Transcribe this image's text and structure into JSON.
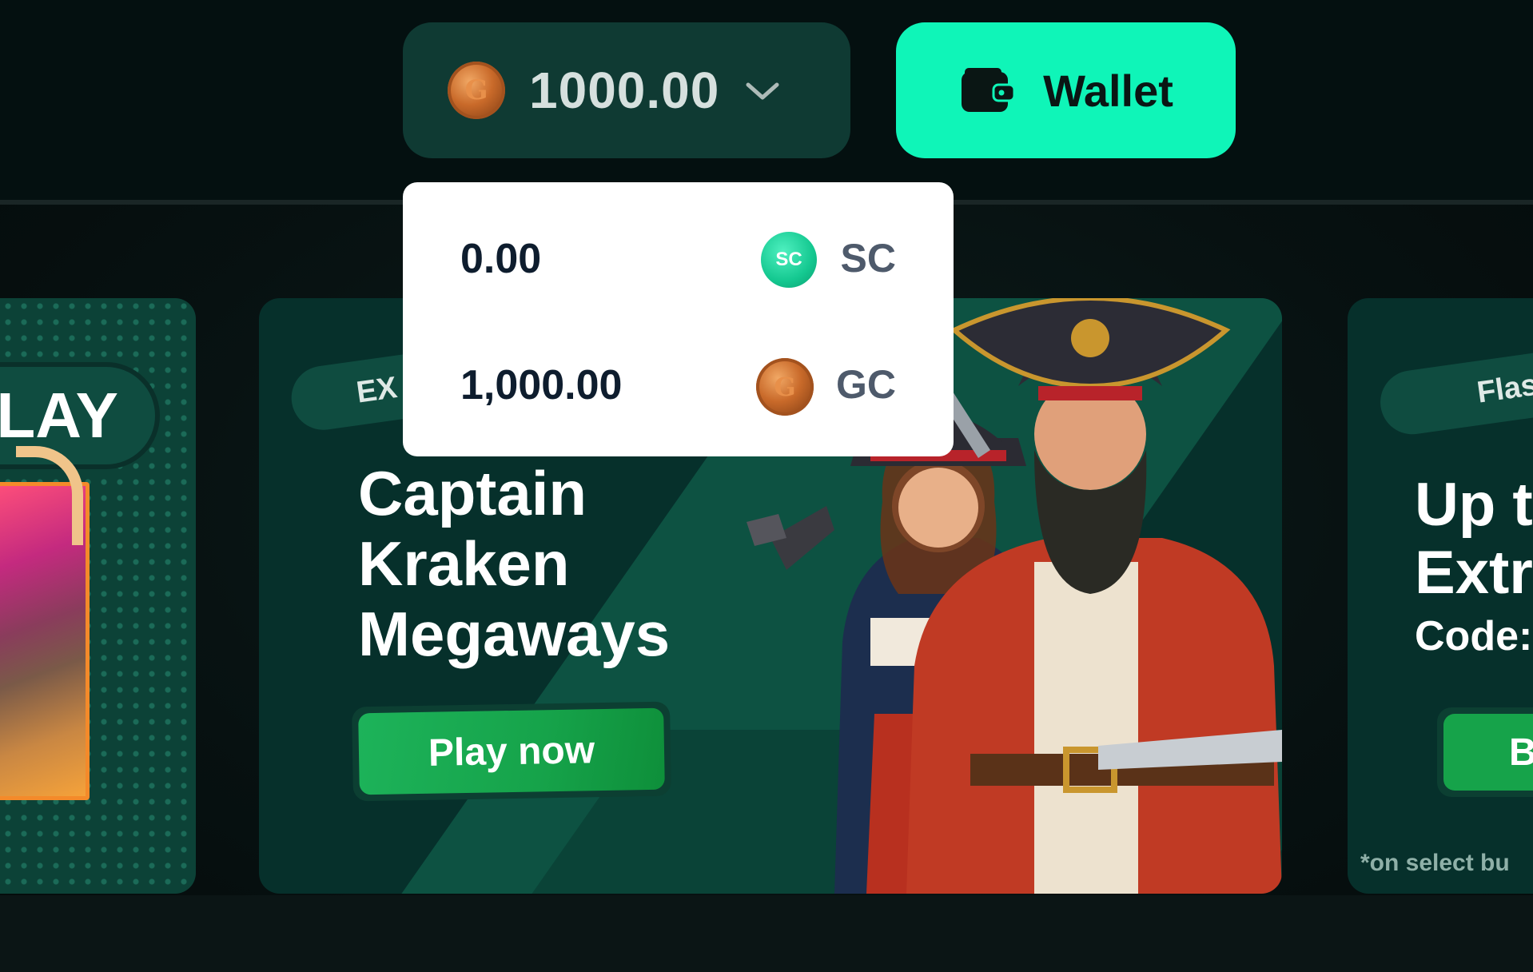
{
  "header": {
    "balance": {
      "amount": "1000.00",
      "coin_icon": "gold-coin-icon",
      "expand_icon": "chevron-down-icon"
    },
    "wallet": {
      "label": "Wallet",
      "icon": "wallet-icon"
    }
  },
  "currency_dropdown": {
    "options": [
      {
        "amount": "0.00",
        "code": "SC",
        "badge": "SC",
        "coin_color": "#14c890"
      },
      {
        "amount": "1,000.00",
        "code": "GC",
        "coin_color": "#c96a2a"
      }
    ]
  },
  "cards": {
    "left": {
      "tag_partial": "LAY"
    },
    "main": {
      "tag_partial": "EX",
      "title_lines": [
        "Captain",
        "Kraken",
        "Megaways"
      ],
      "cta": "Play now"
    },
    "right": {
      "tag_partial": "Flas",
      "headline_lines": [
        "Up t",
        "Extr"
      ],
      "code_partial": "Code:",
      "button_partial": "B",
      "note_partial": "*on select bu"
    }
  },
  "colors": {
    "accent": "#0ff5b8",
    "panel": "#0f3a33",
    "play_green": "#16a34a"
  }
}
